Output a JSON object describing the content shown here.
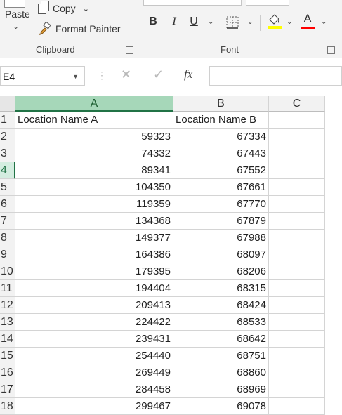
{
  "ribbon": {
    "clipboard": {
      "paste_label": "Paste",
      "copy_label": "Copy",
      "format_painter_label": "Format Painter",
      "group_label": "Clipboard"
    },
    "font": {
      "bold_label": "B",
      "italic_label": "I",
      "underline_label": "U",
      "font_color_label": "A",
      "group_label": "Font",
      "highlight_color": "#ffff00",
      "font_color": "#ff0000"
    }
  },
  "formula_bar": {
    "name_box": "E4",
    "fx_label": "fx",
    "formula": ""
  },
  "sheet": {
    "selected_column": "A",
    "selected_row": "4",
    "columns": [
      "A",
      "B",
      "C"
    ],
    "rows": [
      {
        "num": "1",
        "a": "Location Name A",
        "b": "Location Name B"
      },
      {
        "num": "2",
        "a": "59323",
        "b": "67334"
      },
      {
        "num": "3",
        "a": "74332",
        "b": "67443"
      },
      {
        "num": "4",
        "a": "89341",
        "b": "67552"
      },
      {
        "num": "5",
        "a": "104350",
        "b": "67661"
      },
      {
        "num": "6",
        "a": "119359",
        "b": "67770"
      },
      {
        "num": "7",
        "a": "134368",
        "b": "67879"
      },
      {
        "num": "8",
        "a": "149377",
        "b": "67988"
      },
      {
        "num": "9",
        "a": "164386",
        "b": "68097"
      },
      {
        "num": "10",
        "a": "179395",
        "b": "68206"
      },
      {
        "num": "11",
        "a": "194404",
        "b": "68315"
      },
      {
        "num": "12",
        "a": "209413",
        "b": "68424"
      },
      {
        "num": "13",
        "a": "224422",
        "b": "68533"
      },
      {
        "num": "14",
        "a": "239431",
        "b": "68642"
      },
      {
        "num": "15",
        "a": "254440",
        "b": "68751"
      },
      {
        "num": "16",
        "a": "269449",
        "b": "68860"
      },
      {
        "num": "17",
        "a": "284458",
        "b": "68969"
      },
      {
        "num": "18",
        "a": "299467",
        "b": "69078"
      }
    ]
  }
}
